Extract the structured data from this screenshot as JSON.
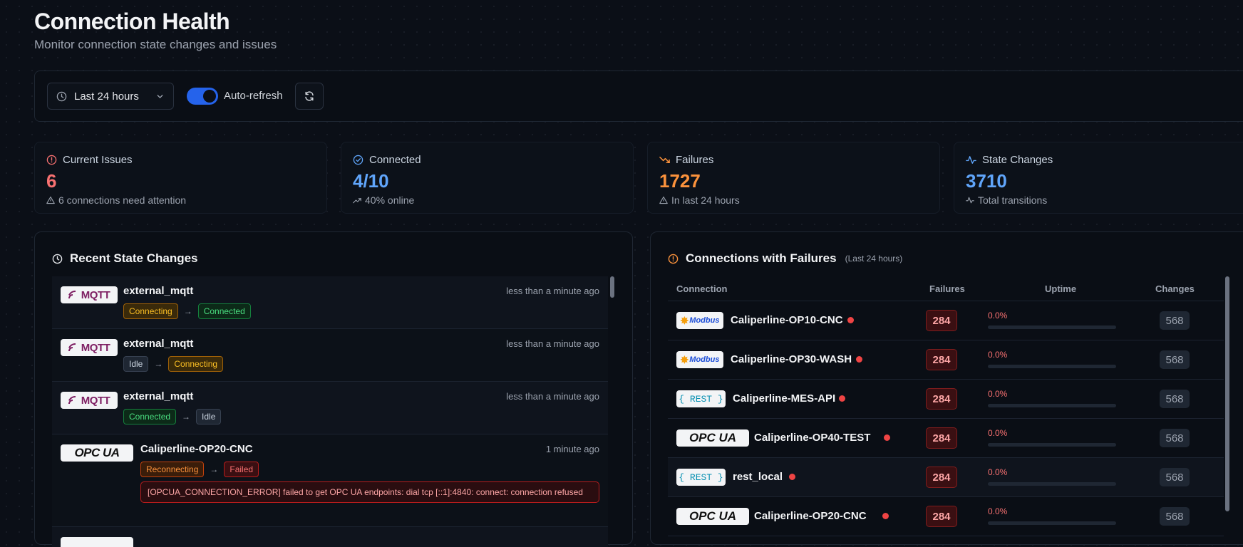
{
  "header": {
    "title": "Connection Health",
    "subtitle": "Monitor connection state changes and issues"
  },
  "toolbar": {
    "time_range": "Last 24 hours",
    "auto_refresh_label": "Auto-refresh",
    "auto_refresh_on": true
  },
  "stats": [
    {
      "label": "Current Issues",
      "value": "6",
      "sub": "6 connections need attention",
      "color": "#f87171"
    },
    {
      "label": "Connected",
      "value": "4/10",
      "sub": "40% online",
      "color": "#60a5fa"
    },
    {
      "label": "Failures",
      "value": "1727",
      "sub": "In last 24 hours",
      "color": "#fb923c"
    },
    {
      "label": "State Changes",
      "value": "3710",
      "sub": "Total transitions",
      "color": "#60a5fa"
    }
  ],
  "recent": {
    "title": "Recent State Changes",
    "items": [
      {
        "logo": "MQTT",
        "name": "external_mqtt",
        "time": "less than a minute ago",
        "from": "Connecting",
        "to": "Connected"
      },
      {
        "logo": "MQTT",
        "name": "external_mqtt",
        "time": "less than a minute ago",
        "from": "Idle",
        "to": "Connecting"
      },
      {
        "logo": "MQTT",
        "name": "external_mqtt",
        "time": "less than a minute ago",
        "from": "Connected",
        "to": "Idle"
      },
      {
        "logo": "OPC UA",
        "name": "Caliperline-OP20-CNC",
        "time": "1 minute ago",
        "from": "Reconnecting",
        "to": "Failed",
        "error": "[OPCUA_CONNECTION_ERROR] failed to get OPC UA endpoints: dial tcp [::1]:4840: connect: connection refused"
      }
    ]
  },
  "failures": {
    "title": "Connections with Failures",
    "note": "(Last 24 hours)",
    "columns": [
      "Connection",
      "Failures",
      "Uptime",
      "Changes"
    ],
    "rows": [
      {
        "logo": "Modbus",
        "name": "Caliperline-OP10-CNC",
        "failures": "284",
        "uptime": "0.0%",
        "uptime_fraction": 0,
        "changes": "568"
      },
      {
        "logo": "Modbus",
        "name": "Caliperline-OP30-WASH",
        "failures": "284",
        "uptime": "0.0%",
        "uptime_fraction": 0,
        "changes": "568"
      },
      {
        "logo": "REST",
        "name": "Caliperline-MES-API",
        "failures": "284",
        "uptime": "0.0%",
        "uptime_fraction": 0,
        "changes": "568"
      },
      {
        "logo": "OPC UA",
        "name": "Caliperline-OP40-TEST",
        "failures": "284",
        "uptime": "0.0%",
        "uptime_fraction": 0,
        "changes": "568"
      },
      {
        "logo": "REST",
        "name": "rest_local",
        "failures": "284",
        "uptime": "0.0%",
        "uptime_fraction": 0,
        "changes": "568"
      },
      {
        "logo": "OPC UA",
        "name": "Caliperline-OP20-CNC",
        "failures": "284",
        "uptime": "0.0%",
        "uptime_fraction": 0,
        "changes": "568"
      }
    ]
  }
}
